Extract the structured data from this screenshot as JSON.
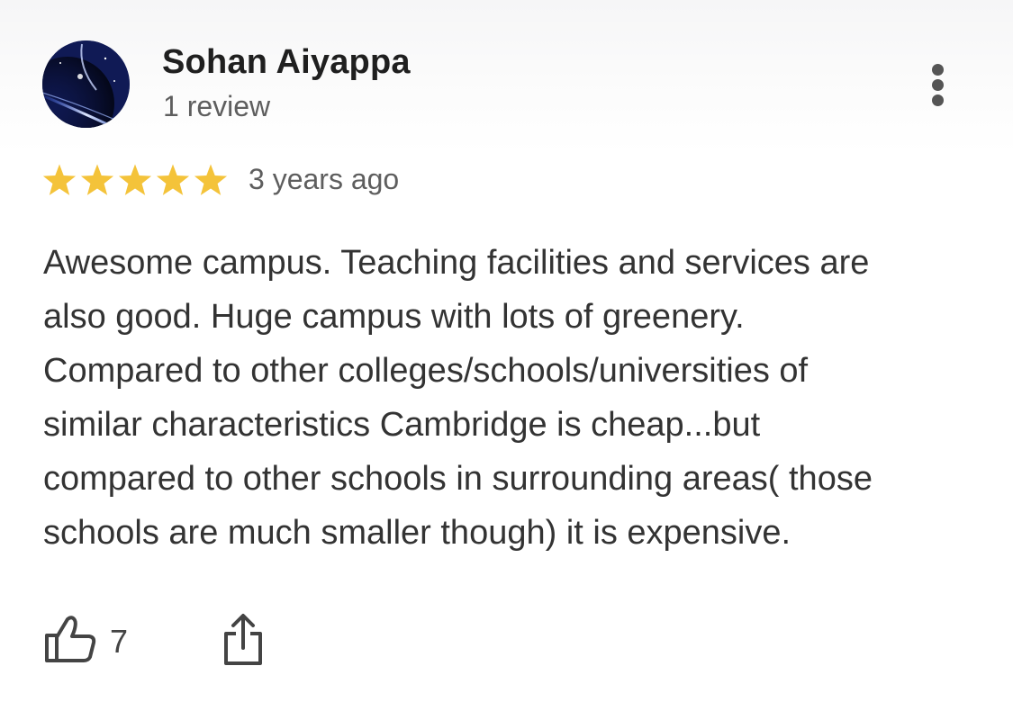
{
  "reviewer": {
    "name": "Sohan Aiyappa",
    "review_count": "1 review",
    "avatar_icon": "planet-avatar-icon"
  },
  "rating": {
    "stars": 5,
    "max_stars": 5,
    "star_color": "#F4C33A"
  },
  "review": {
    "time": "3 years ago",
    "text_lines": [
      "Awesome campus. Teaching facilities and services are",
      "also good. Huge campus with lots of greenery.",
      "Compared to other colleges/schools/universities of",
      "similar characteristics Cambridge is cheap...but",
      "compared to other schools in surrounding areas( those",
      "schools are much smaller though) it is expensive."
    ]
  },
  "actions": {
    "like_count": "7",
    "like_icon": "thumbs-up-icon",
    "share_icon": "share-icon",
    "more_icon": "more-vert-icon"
  },
  "colors": {
    "name": "#1f1f1f",
    "secondary_text": "#5e5e5e",
    "body_text": "#333333",
    "icon": "#444444"
  }
}
